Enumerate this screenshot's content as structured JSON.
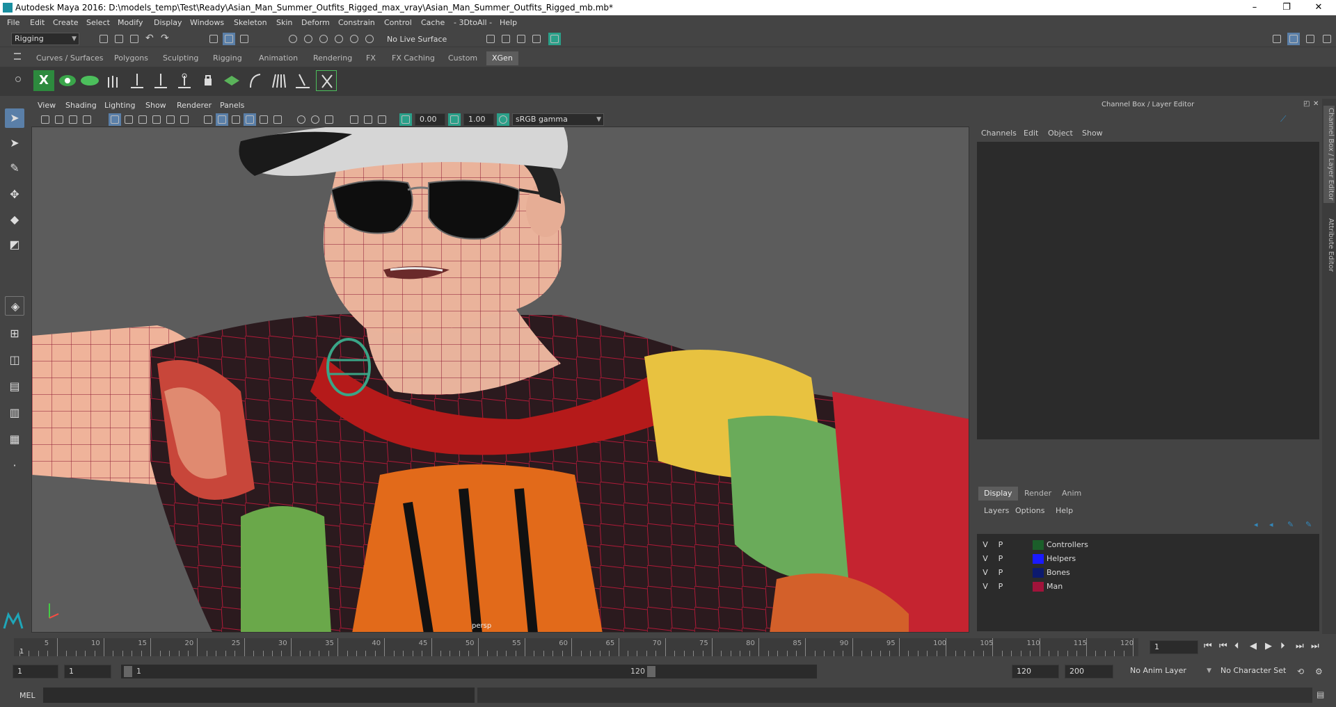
{
  "window": {
    "title": "Autodesk Maya 2016: D:\\models_temp\\Test\\Ready\\Asian_Man_Summer_Outfits_Rigged_max_vray\\Asian_Man_Summer_Outfits_Rigged_mb.mb*",
    "minimize": "–",
    "maximize": "❐",
    "close": "✕"
  },
  "menubar": [
    "File",
    "Edit",
    "Create",
    "Select",
    "Modify",
    "Display",
    "Windows",
    "Skeleton",
    "Skin",
    "Deform",
    "Constrain",
    "Control",
    "Cache",
    "- 3DtoAll -",
    "Help"
  ],
  "statusline": {
    "mode": "Rigging",
    "live_surface": "No Live Surface"
  },
  "shelf": {
    "tabs": [
      "Curves / Surfaces",
      "Polygons",
      "Sculpting",
      "Rigging",
      "Animation",
      "Rendering",
      "FX",
      "FX Caching",
      "Custom",
      "XGen"
    ],
    "active_tab": "XGen"
  },
  "panel": {
    "menus": [
      "View",
      "Shading",
      "Lighting",
      "Show",
      "Renderer",
      "Panels"
    ],
    "exposure": "0.00",
    "gamma": "1.00",
    "color_space": "sRGB gamma",
    "camera_label": "persp"
  },
  "channel_box": {
    "title": "Channel Box / Layer Editor",
    "menus": [
      "Channels",
      "Edit",
      "Object",
      "Show"
    ]
  },
  "layer_editor": {
    "tabs": [
      "Display",
      "Render",
      "Anim"
    ],
    "active_tab": "Display",
    "menus": [
      "Layers",
      "Options",
      "Help"
    ],
    "layers": [
      {
        "v": "V",
        "p": "P",
        "color": "#1b5e2a",
        "name": "Controllers"
      },
      {
        "v": "V",
        "p": "P",
        "color": "#1a1aff",
        "name": "Helpers"
      },
      {
        "v": "V",
        "p": "P",
        "color": "#0c1a6e",
        "name": "Bones"
      },
      {
        "v": "V",
        "p": "P",
        "color": "#a0133a",
        "name": "Man"
      }
    ]
  },
  "right_strip_tabs": [
    "Channel Box / Layer Editor",
    "Attribute Editor"
  ],
  "time_slider": {
    "ticks": [
      "5",
      "10",
      "15",
      "20",
      "25",
      "30",
      "35",
      "40",
      "45",
      "50",
      "55",
      "60",
      "65",
      "70",
      "75",
      "80",
      "85",
      "90",
      "95",
      "100",
      "105",
      "110",
      "115",
      "120"
    ],
    "start_tick": "1",
    "current_frame": "1"
  },
  "range_slider": {
    "start": "1",
    "playback_start": "1",
    "range_start_label": "1",
    "range_end_label": "120",
    "playback_end": "120",
    "end": "200",
    "anim_layer": "No Anim Layer",
    "character_set": "No Character Set"
  },
  "command_line": {
    "label": "MEL"
  }
}
